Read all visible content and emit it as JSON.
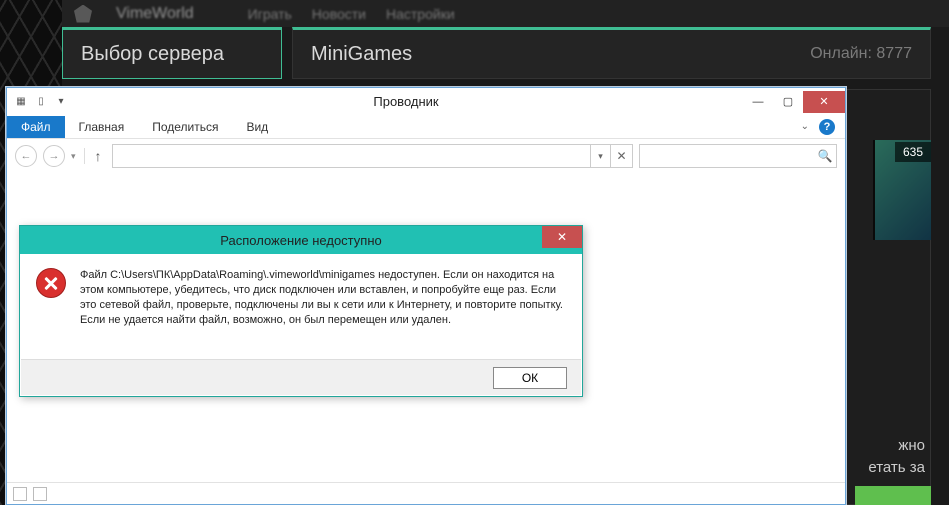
{
  "bg": {
    "brand": "VimeWorld",
    "nav": [
      "Играть",
      "Новости",
      "Настройки"
    ],
    "tab_server": "Выбор сервера",
    "tab_minigames": "MiniGames",
    "online_label": "Онлайн: 8777",
    "right_badge": "635",
    "right_text_1": "жно",
    "right_text_2": "етать за"
  },
  "explorer": {
    "title": "Проводник",
    "tabs": {
      "file": "Файл",
      "home": "Главная",
      "share": "Поделиться",
      "view": "Вид"
    },
    "search_placeholder": ""
  },
  "dialog": {
    "title": "Расположение недоступно",
    "message": "Файл C:\\Users\\ПК\\AppData\\Roaming\\.vimeworld\\minigames недоступен. Если он находится на этом компьютере, убедитесь, что диск подключен или вставлен, и попробуйте еще раз. Если это сетевой файл, проверьте, подключены ли вы к сети или к Интернету, и повторите попытку. Если не удается найти файл, возможно, он был перемещен или удален.",
    "ok": "ОК"
  }
}
